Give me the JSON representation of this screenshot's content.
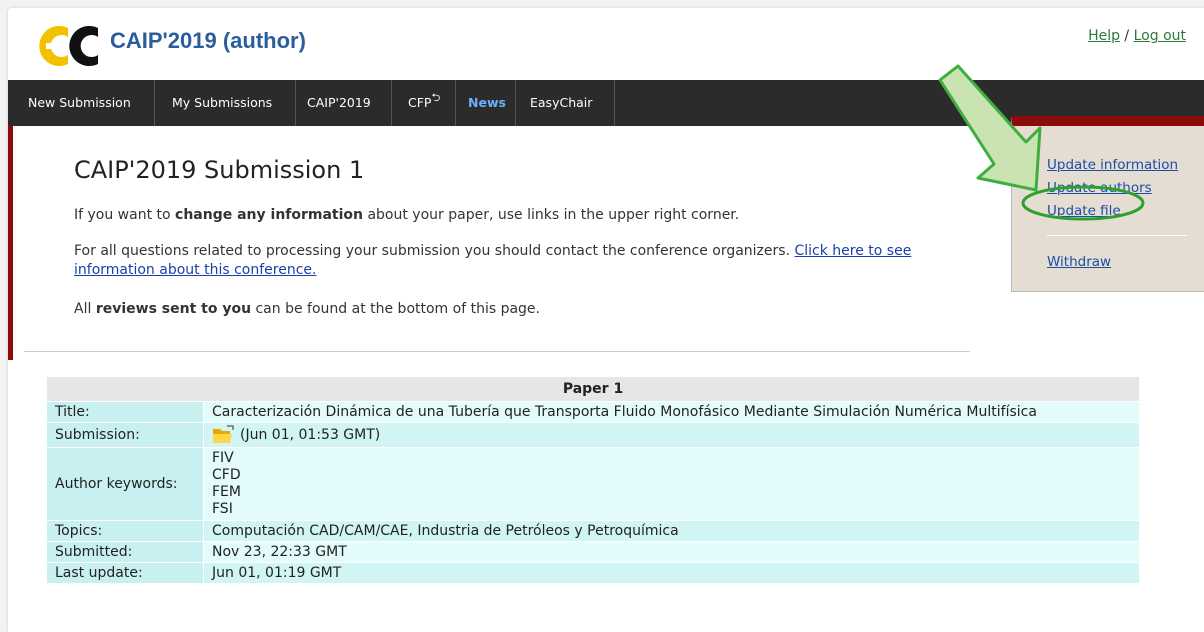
{
  "header": {
    "app_title": "CAIP'2019 (author)",
    "help_label": "Help",
    "sep": " / ",
    "logout_label": "Log out"
  },
  "nav": {
    "items": [
      "New Submission",
      "My Submissions",
      "CAIP'2019",
      "CFP",
      "News",
      "EasyChair"
    ]
  },
  "main": {
    "title": "CAIP'2019 Submission 1",
    "p1_pre": "If you want to ",
    "p1_bold": "change any information",
    "p1_post": " about your paper, use links in the upper right corner.",
    "p2_pre": "For all questions related to processing your submission you should contact the conference organizers. ",
    "p2_link": "Click here to see information about this conference.",
    "p3_pre": "All ",
    "p3_bold": "reviews sent to you",
    "p3_post": " can be found at the bottom of this page."
  },
  "side": {
    "update_information": "Update information",
    "update_authors": "Update authors",
    "update_file": "Update file",
    "withdraw": "Withdraw"
  },
  "paper": {
    "header": "Paper 1",
    "rows": {
      "title_label": "Title:",
      "title_value": "Caracterización Dinámica de una Tubería que Transporta Fluido Monofásico Mediante Simulación Numérica Multifísica",
      "submission_label": "Submission:",
      "submission_value": "(Jun 01, 01:53 GMT)",
      "keywords_label": "Author keywords:",
      "keywords": [
        "FIV",
        "CFD",
        "FEM",
        "FSI"
      ],
      "topics_label": "Topics:",
      "topics_value": "Computación CAD/CAM/CAE, Industria de Petróleos y Petroquímica",
      "submitted_label": "Submitted:",
      "submitted_value": "Nov 23, 22:33 GMT",
      "lastupdate_label": "Last update:",
      "lastupdate_value": "Jun 01, 01:19 GMT"
    }
  },
  "icons": {
    "logo": "easychair-logo",
    "folder": "folder-icon",
    "cfp_return": "return-icon",
    "annotation_arrow": "green-arrow",
    "annotation_ellipse": "green-ellipse"
  },
  "colors": {
    "brand_blue": "#2b5d9a",
    "nav_bg": "#2b2b2b",
    "accent_red": "#8e0b0b",
    "annotation_green": "#3fae3f",
    "table_label": "#c8f0f0",
    "table_value": "#e3fbfb"
  }
}
